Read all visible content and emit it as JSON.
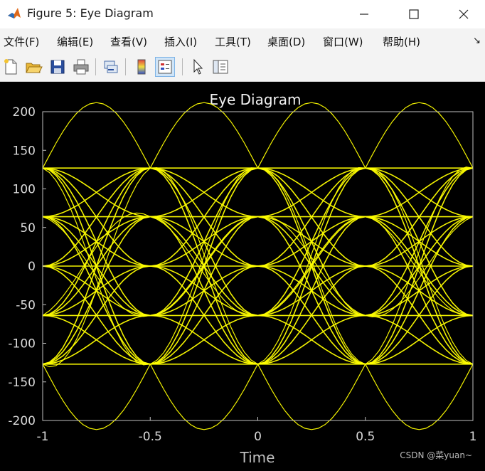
{
  "window": {
    "title": "Figure 5: Eye Diagram",
    "minimize_icon": "minimize-icon",
    "maximize_icon": "maximize-icon",
    "close_icon": "close-icon"
  },
  "menu": {
    "items": [
      "文件(F)",
      "编辑(E)",
      "查看(V)",
      "插入(I)",
      "工具(T)",
      "桌面(D)",
      "窗口(W)",
      "帮助(H)"
    ],
    "overflow_icon": "chevron-icon"
  },
  "toolbar": {
    "buttons": [
      "new-figure-icon",
      "open-file-icon",
      "save-icon",
      "print-icon",
      "link-icon",
      "colorbar-icon",
      "legend-icon",
      "pointer-icon",
      "property-inspector-icon"
    ]
  },
  "colors": {
    "trace": "#ffff00",
    "axes_background": "#000000",
    "axes_text": "#d9d9d9",
    "axes_box": "#bfbfbf"
  },
  "watermark": "CSDN @菜yuan~",
  "chart_data": {
    "type": "line",
    "title": "Eye Diagram",
    "xlabel": "Time",
    "ylabel": "",
    "xlim": [
      -1,
      1
    ],
    "ylim": [
      -200,
      200
    ],
    "xticks": [
      "-1",
      "-0.5",
      "0",
      "0.5",
      "1"
    ],
    "yticks": [
      "200",
      "150",
      "100",
      "50",
      "0",
      "-50",
      "-100",
      "-150",
      "-200"
    ],
    "grid": false,
    "symbol_period": 0.5,
    "symbol_levels": [
      -127,
      -64,
      0,
      64,
      127
    ],
    "peak_amplitude": 180,
    "trace_color": "#ffff00"
  }
}
